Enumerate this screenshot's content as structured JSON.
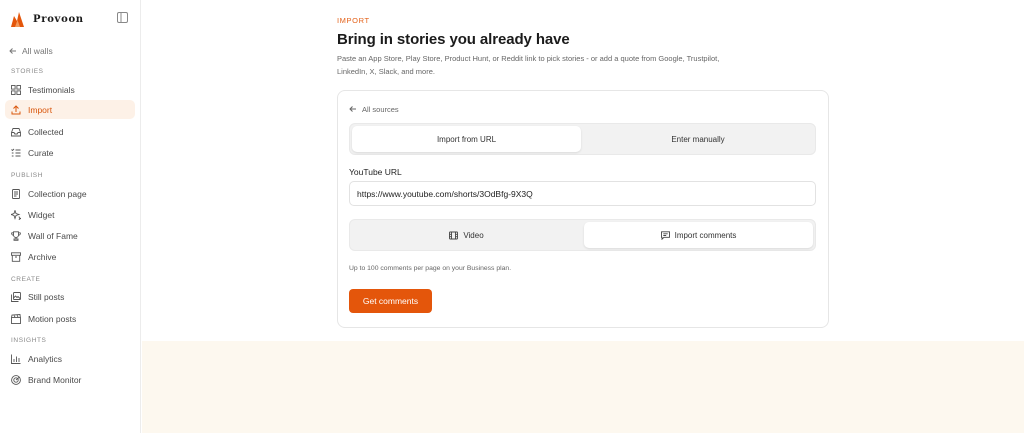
{
  "brand": {
    "name": "Provoon",
    "accent": "#e4560b"
  },
  "sidebar": {
    "back_label": "All walls",
    "sections": [
      {
        "title": "STORIES",
        "items": [
          {
            "label": "Testimonials",
            "icon": "grid-icon",
            "active": false
          },
          {
            "label": "Import",
            "icon": "upload-icon",
            "active": true
          },
          {
            "label": "Collected",
            "icon": "inbox-icon",
            "active": false
          },
          {
            "label": "Curate",
            "icon": "list-check-icon",
            "active": false
          }
        ]
      },
      {
        "title": "PUBLISH",
        "items": [
          {
            "label": "Collection page",
            "icon": "page-icon",
            "active": false
          },
          {
            "label": "Widget",
            "icon": "sparkle-icon",
            "active": false
          },
          {
            "label": "Wall of Fame",
            "icon": "trophy-icon",
            "active": false
          },
          {
            "label": "Archive",
            "icon": "archive-icon",
            "active": false
          }
        ]
      },
      {
        "title": "CREATE",
        "items": [
          {
            "label": "Still posts",
            "icon": "images-icon",
            "active": false
          },
          {
            "label": "Motion posts",
            "icon": "clapperboard-icon",
            "active": false
          }
        ]
      },
      {
        "title": "INSIGHTS",
        "items": [
          {
            "label": "Analytics",
            "icon": "bar-chart-icon",
            "active": false
          },
          {
            "label": "Brand Monitor",
            "icon": "radar-icon",
            "active": false
          }
        ]
      }
    ]
  },
  "main": {
    "eyebrow": "IMPORT",
    "title": "Bring in stories you already have",
    "subtitle": "Paste an App Store, Play Store, Product Hunt, or Reddit link to pick stories - or add a quote from Google, Trustpilot, LinkedIn, X, Slack, and more."
  },
  "card": {
    "back_label": "All sources",
    "mode_tabs": [
      {
        "label": "Import from URL",
        "selected": true
      },
      {
        "label": "Enter manually",
        "selected": false
      }
    ],
    "field_label": "YouTube URL",
    "url_value": "https://www.youtube.com/shorts/3OdBfg-9X3Q",
    "type_tabs": [
      {
        "label": "Video",
        "icon": "film-icon",
        "selected": false
      },
      {
        "label": "Import comments",
        "icon": "comment-icon",
        "selected": true
      }
    ],
    "helper_text": "Up to 100 comments per page on your Business plan.",
    "submit_label": "Get comments"
  }
}
